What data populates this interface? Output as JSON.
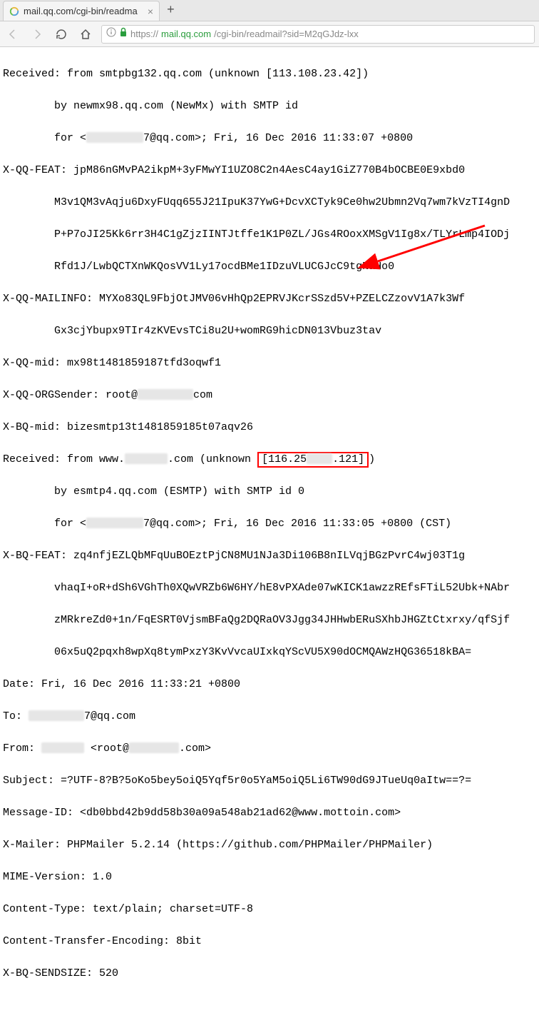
{
  "browser": {
    "tab_title": "mail.qq.com/cgi-bin/readma",
    "url_proto": "https://",
    "url_host": "mail.qq.com",
    "url_path": "/cgi-bin/readmail?sid=M2qGJdz-lxx"
  },
  "headers": {
    "received1_l1_a": "Received: from smtpbg132.qq.com (unknown [113.108.23.42])",
    "received1_l2": "by newmx98.qq.com (NewMx) with SMTP id",
    "received1_l3_a": "for <",
    "received1_l3_b": "7@qq.com>; Fri, 16 Dec 2016 11:33:07 +0800",
    "xqqfeat_l1": "X-QQ-FEAT: jpM86nGMvPA2ikpM+3yFMwYI1UZO8C2n4AesC4ay1GiZ770B4bOCBE0E9xbd0",
    "xqqfeat_l2": "M3v1QM3vAqju6DxyFUqq655J21IpuK37YwG+DcvXCTyk9Ce0hw2Ubmn2Vq7wm7kVzTI4gnD",
    "xqqfeat_l3": "P+P7oJI25Kk6rr3H4C1gZjzIINTJtffe1K1P0ZL/JGs4ROoxXMSgV1Ig8x/TLYrLmp4IODj",
    "xqqfeat_l4": "Rfd1J/LwbQCTXnWKQosVV1Ly17ocdBMe1IDzuVLUCGJcC9tgNaHo0",
    "xqqmailinfo_l1": "X-QQ-MAILINFO: MYXo83QL9FbjOtJMV06vHhQp2EPRVJKcrSSzd5V+PZELCZzovV1A7k3Wf",
    "xqqmailinfo_l2": "Gx3cjYbupx9TIr4zKVEvsTCi8u2U+womRG9hicDN013Vbuz3tav",
    "xqqmid": "X-QQ-mid: mx98t1481859187tfd3oqwf1",
    "xqqorgsender_a": "X-QQ-ORGSender: root@",
    "xqqorgsender_b": "com",
    "xbqmid": "X-BQ-mid: bizesmtp13t1481859185t07aqv26",
    "received2_l1_a": "Received: from www.",
    "received2_l1_b": ".com (unknown ",
    "received2_l1_box_a": "[116.25",
    "received2_l1_box_b": ".121]",
    "received2_l1_c": ")",
    "received2_l2": "by esmtp4.qq.com (ESMTP) with SMTP id 0",
    "received2_l3_a": "for <",
    "received2_l3_b": "7@qq.com>; Fri, 16 Dec 2016 11:33:05 +0800 (CST)",
    "xbqfeat_l1": "X-BQ-FEAT: zq4nfjEZLQbMFqUuBOEztPjCN8MU1NJa3Di106B8nILVqjBGzPvrC4wj03T1g",
    "xbqfeat_l2": "vhaqI+oR+dSh6VGhTh0XQwVRZb6W6HY/hE8vPXAde07wKICK1awzzREfsFTiL52Ubk+NAbr",
    "xbqfeat_l3": "zMRkreZd0+1n/FqESRT0VjsmBFaQg2DQRaOV3Jgg34JHHwbERuSXhbJHGZtCtxrxy/qfSjf",
    "xbqfeat_l4": "06x5uQ2pqxh8wpXq8tymPxzY3KvVvcaUIxkqYScVU5X90dOCMQAWzHQG36518kBA=",
    "date": "Date: Fri, 16 Dec 2016 11:33:21 +0800",
    "to_a": "To: ",
    "to_b": "7@qq.com",
    "from_a": "From: ",
    "from_b": " <root@",
    "from_c": ".com>",
    "subject": "Subject: =?UTF-8?B?5oKo5bey5oiQ5Yqf5r0o5YaM5oiQ5Li6TW90dG9JTueUq0aItw==?=",
    "msgid": "Message-ID: <db0bbd42b9dd58b30a09a548ab21ad62@www.mottoin.com>",
    "xmailer": "X-Mailer: PHPMailer 5.2.14 (https://github.com/PHPMailer/PHPMailer)",
    "mime": "MIME-Version: 1.0",
    "ctype": "Content-Type: text/plain; charset=UTF-8",
    "cte": "Content-Transfer-Encoding: 8bit",
    "sendsize": "X-BQ-SENDSIZE: 520"
  }
}
